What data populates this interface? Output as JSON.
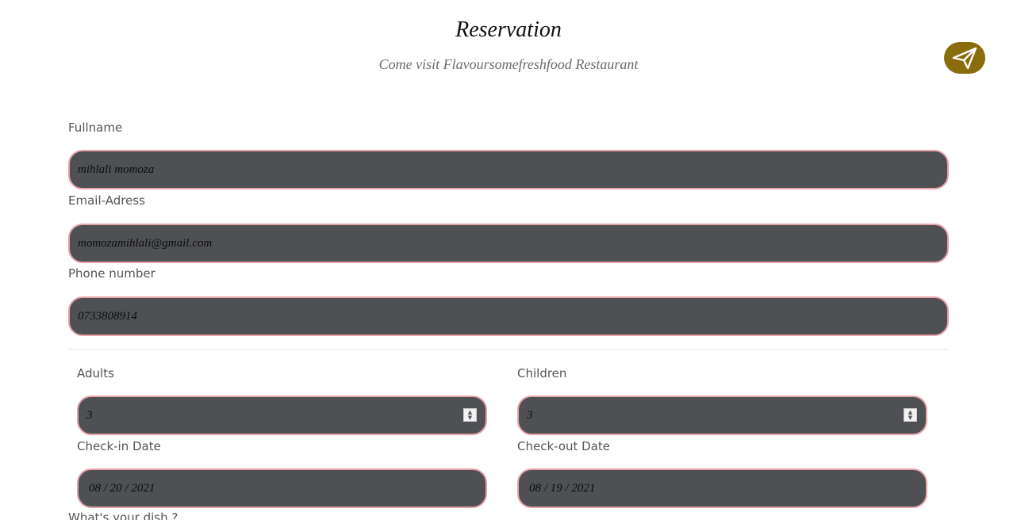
{
  "header": {
    "title": "Reservation",
    "subtitle": "Come visit Flavoursomefreshfood Restaurant"
  },
  "actions": {
    "send_icon": "paper-plane-icon",
    "send_color": "#8a6c0c"
  },
  "form": {
    "fullname": {
      "label": "Fullname",
      "value": "mihlali momoza"
    },
    "email": {
      "label": "Email-Adress",
      "value": "momozamihlali@gmail.com"
    },
    "phone": {
      "label": "Phone number",
      "value": "0733808914"
    },
    "adults": {
      "label": "Adults",
      "value": "3"
    },
    "children": {
      "label": "Children",
      "value": "3"
    },
    "checkin": {
      "label": "Check-in Date",
      "value": "08 / 20 / 2021"
    },
    "checkout": {
      "label": "Check-out Date",
      "value": "08 / 19 / 2021"
    },
    "dish": {
      "label": "What's your dish ?"
    }
  },
  "colors": {
    "field_bg": "#4e5054",
    "field_border": "#e6a3a8"
  }
}
